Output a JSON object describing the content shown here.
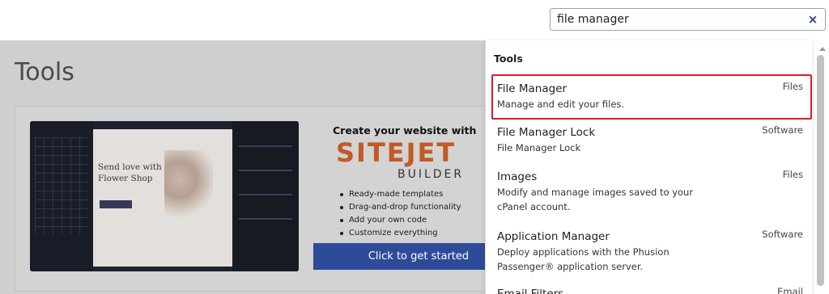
{
  "search": {
    "value": "file manager",
    "clear_glyph": "×"
  },
  "page": {
    "title": "Tools"
  },
  "promo": {
    "headline": "Create your website with",
    "logo_main": "SITEJET",
    "logo_sub": "BUILDER",
    "screenshot_heading": "Send love with Flower Shop",
    "features": [
      "Ready-made templates",
      "Drag-and-drop functionality",
      "Add your own code",
      "Customize everything"
    ],
    "cta_label": "Click to get started",
    "brand_color": "#c25a26",
    "cta_color": "#2d4b99"
  },
  "dropdown": {
    "header": "Tools",
    "items": [
      {
        "name": "File Manager",
        "description": "Manage and edit your files.",
        "category": "Files",
        "selected": true
      },
      {
        "name": "File Manager Lock",
        "description": "File Manager Lock",
        "category": "Software",
        "selected": false
      },
      {
        "name": "Images",
        "description": "Modify and manage images saved to your cPanel account.",
        "category": "Files",
        "selected": false
      },
      {
        "name": "Application Manager",
        "description": "Deploy applications with the Phusion Passenger® application server.",
        "category": "Software",
        "selected": false
      },
      {
        "name": "Email Filters",
        "description": "",
        "category": "Email",
        "selected": false
      }
    ],
    "highlight_color": "#d81e26"
  },
  "icons": {
    "clear": "close-icon",
    "scroll_up": "chevron-up-icon"
  }
}
